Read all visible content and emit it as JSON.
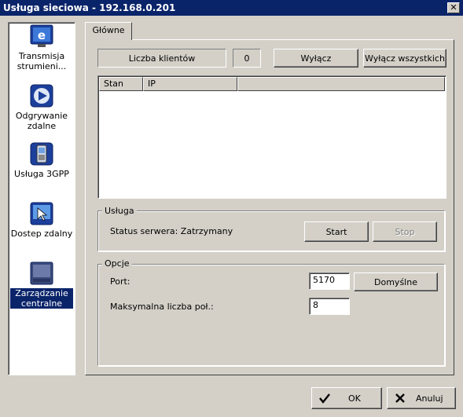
{
  "window": {
    "title": "Usługa sieciowa - 192.168.0.201",
    "close_label": "✕"
  },
  "sidebar": {
    "items": [
      {
        "label": "Transmisja strumieni...",
        "icon": "streaming-icon",
        "selected": false
      },
      {
        "label": "Odgrywanie zdalne",
        "icon": "remote-playback-icon",
        "selected": false
      },
      {
        "label": "Usługa 3GPP",
        "icon": "mobile-3gpp-icon",
        "selected": false
      },
      {
        "label": "Dostep zdalny",
        "icon": "remote-access-icon",
        "selected": false
      },
      {
        "label": "Zarządzanie centralne",
        "icon": "central-management-icon",
        "selected": true
      }
    ]
  },
  "tabs": [
    {
      "label": "Główne",
      "active": true
    }
  ],
  "clients": {
    "count_label": "Liczba klientów",
    "count_value": "0",
    "disconnect_label": "Wyłącz",
    "disconnect_all_label": "Wyłącz wszystkich",
    "columns": [
      "Stan",
      "IP"
    ],
    "rows": []
  },
  "service": {
    "group_label": "Usługa",
    "status_text": "Status serwera: Zatrzymany",
    "start_label": "Start",
    "stop_label": "Stop"
  },
  "options": {
    "group_label": "Opcje",
    "port_label": "Port:",
    "port_value": "5170",
    "default_label": "Domyślne",
    "max_conn_label": "Maksymalna liczba poł.:",
    "max_conn_value": "8"
  },
  "footer": {
    "ok_label": "OK",
    "cancel_label": "Anuluj"
  },
  "colors": {
    "titlebar": "#0a246a",
    "face": "#d4d0c8",
    "selection": "#0a246a"
  }
}
